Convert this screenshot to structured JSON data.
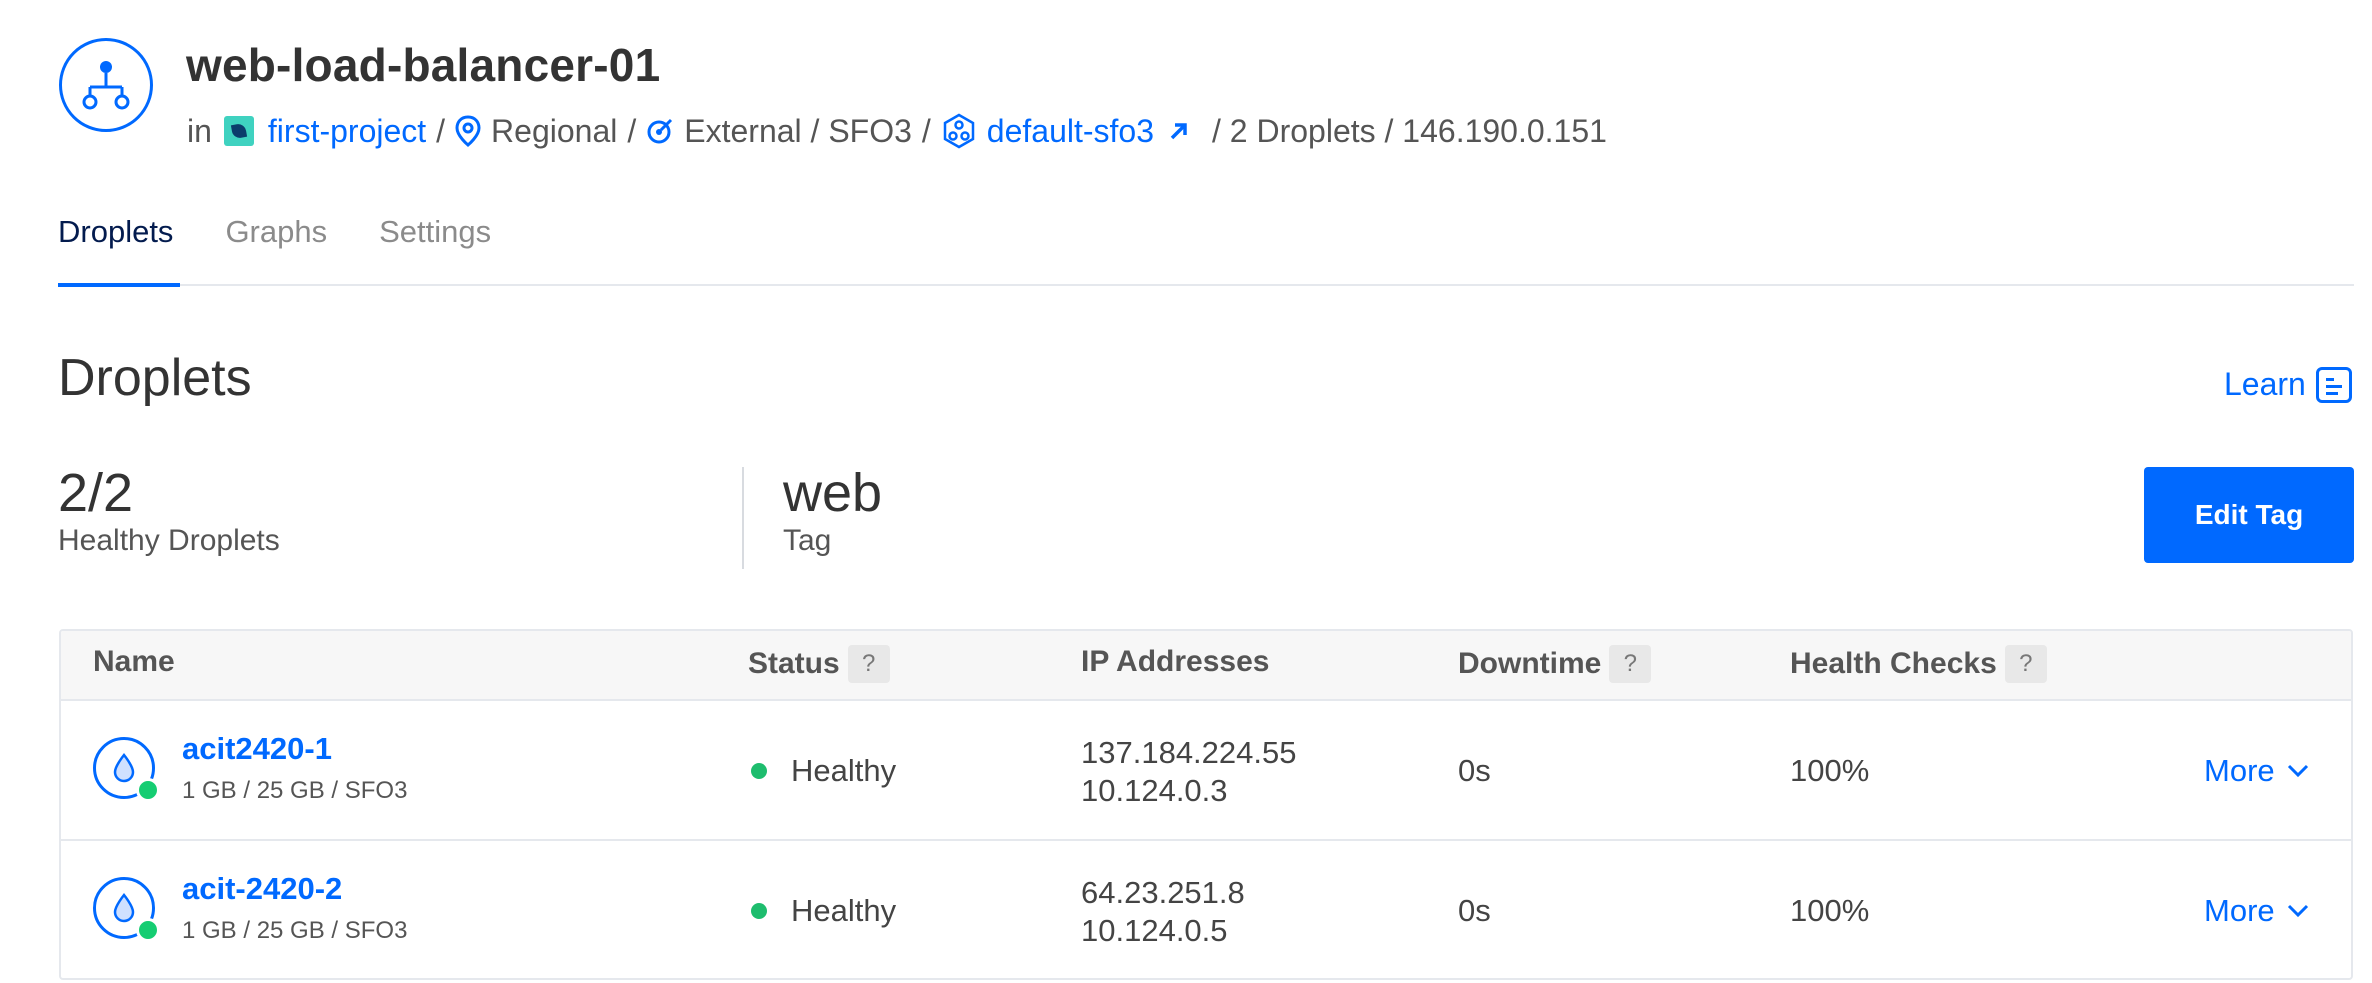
{
  "header": {
    "title": "web-load-balancer-01",
    "in_label": "in",
    "project": "first-project",
    "scope": "Regional",
    "network": "External / SFO3",
    "vpc": "default-sfo3",
    "droplets_count": "/ 2 Droplets / 146.190.0.151",
    "sep": "/"
  },
  "tabs": [
    {
      "label": "Droplets",
      "active": true
    },
    {
      "label": "Graphs",
      "active": false
    },
    {
      "label": "Settings",
      "active": false
    }
  ],
  "section": {
    "title": "Droplets",
    "learn": "Learn",
    "healthy_value": "2/2",
    "healthy_label": "Healthy Droplets",
    "tag_value": "web",
    "tag_label": "Tag",
    "edit_tag": "Edit Tag"
  },
  "table": {
    "columns": {
      "name": "Name",
      "status": "Status",
      "ip": "IP Addresses",
      "downtime": "Downtime",
      "health": "Health Checks",
      "help": "?"
    },
    "rows": [
      {
        "name": "acit2420-1",
        "spec": "1 GB / 25 GB / SFO3",
        "status": "Healthy",
        "public_ip": "137.184.224.55",
        "private_ip": "10.124.0.3",
        "downtime": "0s",
        "health": "100%",
        "more": "More"
      },
      {
        "name": "acit-2420-2",
        "spec": "1 GB / 25 GB / SFO3",
        "status": "Healthy",
        "public_ip": "64.23.251.8",
        "private_ip": "10.124.0.5",
        "downtime": "0s",
        "health": "100%",
        "more": "More"
      }
    ]
  },
  "colors": {
    "accent": "#0069ff",
    "healthy": "#1ebd6e",
    "online": "#15cd72"
  }
}
